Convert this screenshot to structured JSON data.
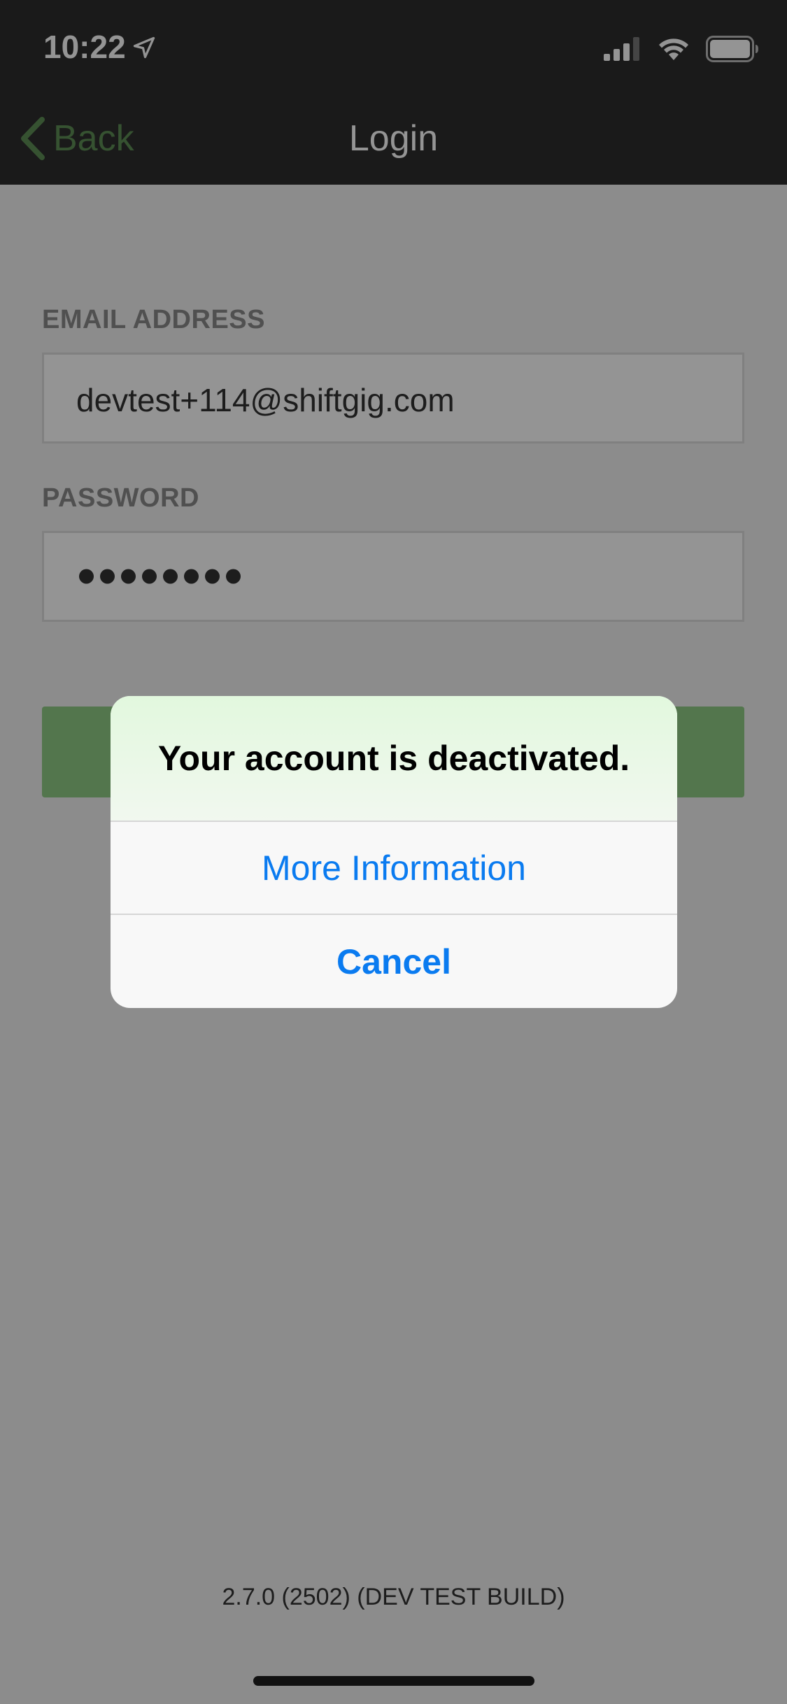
{
  "status_bar": {
    "time": "10:22"
  },
  "nav": {
    "back_label": "Back",
    "title": "Login"
  },
  "form": {
    "email_label": "EMAIL ADDRESS",
    "email_value": "devtest+114@shiftgig.com",
    "password_label": "PASSWORD",
    "password_mask_count": 8
  },
  "footer": {
    "version": "2.7.0 (2502) (DEV TEST BUILD)"
  },
  "alert": {
    "title": "Your account is deactivated.",
    "more_label": "More Information",
    "cancel_label": "Cancel"
  },
  "colors": {
    "accent_green": "#5d8e55",
    "ios_blue": "#0a7bf0",
    "header_bg": "#2d2d2d"
  }
}
